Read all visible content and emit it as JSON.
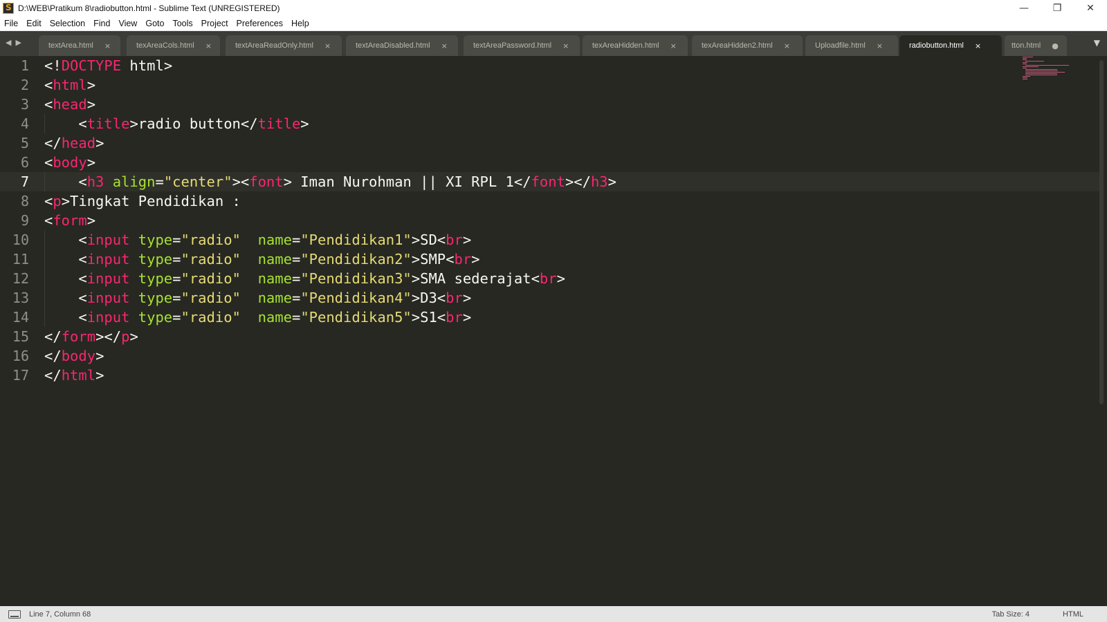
{
  "window": {
    "title": "D:\\WEB\\Pratikum 8\\radiobutton.html - Sublime Text (UNREGISTERED)",
    "minimize": "—",
    "restore": "❐",
    "close": "✕"
  },
  "menu": [
    "File",
    "Edit",
    "Selection",
    "Find",
    "View",
    "Goto",
    "Tools",
    "Project",
    "Preferences",
    "Help"
  ],
  "tabs": [
    {
      "label": "textArea.html",
      "close": "×"
    },
    {
      "label": "texAreaCols.html",
      "close": "×"
    },
    {
      "label": "textAreaReadOnly.html",
      "close": "×"
    },
    {
      "label": "textAreaDisabled.html",
      "close": "×"
    },
    {
      "label": "textAreaPassword.html",
      "close": "×"
    },
    {
      "label": "texAreaHidden.html",
      "close": "×"
    },
    {
      "label": "texAreaHidden2.html",
      "close": "×"
    },
    {
      "label": "Uploadfile.html",
      "close": "×"
    },
    {
      "label": "radiobutton.html",
      "close": "×",
      "active": true
    },
    {
      "label": "tton.html",
      "close": "●"
    }
  ],
  "tab_nav": {
    "left": "◀",
    "right": "▶",
    "dropdown": "▼"
  },
  "code_lines": [
    [
      [
        "p",
        "<!"
      ],
      [
        "t",
        "DOCTYPE"
      ],
      [
        "x",
        " html"
      ],
      [
        "p",
        ">"
      ]
    ],
    [
      [
        "p",
        "<"
      ],
      [
        "t",
        "html"
      ],
      [
        "p",
        ">"
      ]
    ],
    [
      [
        "p",
        "<"
      ],
      [
        "t",
        "head"
      ],
      [
        "p",
        ">"
      ]
    ],
    [
      [
        "x",
        "    "
      ],
      [
        "p",
        "<"
      ],
      [
        "t",
        "title"
      ],
      [
        "p",
        ">"
      ],
      [
        "x",
        "radio button"
      ],
      [
        "p",
        "</"
      ],
      [
        "t",
        "title"
      ],
      [
        "p",
        ">"
      ]
    ],
    [
      [
        "p",
        "</"
      ],
      [
        "t",
        "head"
      ],
      [
        "p",
        ">"
      ]
    ],
    [
      [
        "p",
        "<"
      ],
      [
        "t",
        "body"
      ],
      [
        "p",
        ">"
      ]
    ],
    [
      [
        "x",
        "    "
      ],
      [
        "p",
        "<"
      ],
      [
        "t",
        "h3"
      ],
      [
        "x",
        " "
      ],
      [
        "a",
        "align"
      ],
      [
        "p",
        "="
      ],
      [
        "s",
        "\"center\""
      ],
      [
        "p",
        "><"
      ],
      [
        "t",
        "font"
      ],
      [
        "p",
        ">"
      ],
      [
        "x",
        " Iman Nurohman || XI RPL 1"
      ],
      [
        "p",
        "</"
      ],
      [
        "t",
        "font"
      ],
      [
        "p",
        "></"
      ],
      [
        "t",
        "h3"
      ],
      [
        "p",
        ">"
      ]
    ],
    [
      [
        "p",
        "<"
      ],
      [
        "t",
        "p"
      ],
      [
        "p",
        ">"
      ],
      [
        "x",
        "Tingkat Pendidikan :"
      ]
    ],
    [
      [
        "p",
        "<"
      ],
      [
        "t",
        "form"
      ],
      [
        "p",
        ">"
      ]
    ],
    [
      [
        "x",
        "    "
      ],
      [
        "p",
        "<"
      ],
      [
        "t",
        "input"
      ],
      [
        "x",
        " "
      ],
      [
        "a",
        "type"
      ],
      [
        "p",
        "="
      ],
      [
        "s",
        "\"radio\""
      ],
      [
        "x",
        "  "
      ],
      [
        "a",
        "name"
      ],
      [
        "p",
        "="
      ],
      [
        "s",
        "\"Pendidikan1\""
      ],
      [
        "p",
        ">"
      ],
      [
        "x",
        "SD"
      ],
      [
        "p",
        "<"
      ],
      [
        "t",
        "br"
      ],
      [
        "p",
        ">"
      ]
    ],
    [
      [
        "x",
        "    "
      ],
      [
        "p",
        "<"
      ],
      [
        "t",
        "input"
      ],
      [
        "x",
        " "
      ],
      [
        "a",
        "type"
      ],
      [
        "p",
        "="
      ],
      [
        "s",
        "\"radio\""
      ],
      [
        "x",
        "  "
      ],
      [
        "a",
        "name"
      ],
      [
        "p",
        "="
      ],
      [
        "s",
        "\"Pendidikan2\""
      ],
      [
        "p",
        ">"
      ],
      [
        "x",
        "SMP"
      ],
      [
        "p",
        "<"
      ],
      [
        "t",
        "br"
      ],
      [
        "p",
        ">"
      ]
    ],
    [
      [
        "x",
        "    "
      ],
      [
        "p",
        "<"
      ],
      [
        "t",
        "input"
      ],
      [
        "x",
        " "
      ],
      [
        "a",
        "type"
      ],
      [
        "p",
        "="
      ],
      [
        "s",
        "\"radio\""
      ],
      [
        "x",
        "  "
      ],
      [
        "a",
        "name"
      ],
      [
        "p",
        "="
      ],
      [
        "s",
        "\"Pendidikan3\""
      ],
      [
        "p",
        ">"
      ],
      [
        "x",
        "SMA sederajat"
      ],
      [
        "p",
        "<"
      ],
      [
        "t",
        "br"
      ],
      [
        "p",
        ">"
      ]
    ],
    [
      [
        "x",
        "    "
      ],
      [
        "p",
        "<"
      ],
      [
        "t",
        "input"
      ],
      [
        "x",
        " "
      ],
      [
        "a",
        "type"
      ],
      [
        "p",
        "="
      ],
      [
        "s",
        "\"radio\""
      ],
      [
        "x",
        "  "
      ],
      [
        "a",
        "name"
      ],
      [
        "p",
        "="
      ],
      [
        "s",
        "\"Pendidikan4\""
      ],
      [
        "p",
        ">"
      ],
      [
        "x",
        "D3"
      ],
      [
        "p",
        "<"
      ],
      [
        "t",
        "br"
      ],
      [
        "p",
        ">"
      ]
    ],
    [
      [
        "x",
        "    "
      ],
      [
        "p",
        "<"
      ],
      [
        "t",
        "input"
      ],
      [
        "x",
        " "
      ],
      [
        "a",
        "type"
      ],
      [
        "p",
        "="
      ],
      [
        "s",
        "\"radio\""
      ],
      [
        "x",
        "  "
      ],
      [
        "a",
        "name"
      ],
      [
        "p",
        "="
      ],
      [
        "s",
        "\"Pendidikan5\""
      ],
      [
        "p",
        ">"
      ],
      [
        "x",
        "S1"
      ],
      [
        "p",
        "<"
      ],
      [
        "t",
        "br"
      ],
      [
        "p",
        ">"
      ]
    ],
    [
      [
        "p",
        "</"
      ],
      [
        "t",
        "form"
      ],
      [
        "p",
        "></"
      ],
      [
        "t",
        "p"
      ],
      [
        "p",
        ">"
      ]
    ],
    [
      [
        "p",
        "</"
      ],
      [
        "t",
        "body"
      ],
      [
        "p",
        ">"
      ]
    ],
    [
      [
        "p",
        "</"
      ],
      [
        "t",
        "html"
      ],
      [
        "p",
        ">"
      ]
    ]
  ],
  "current_line": 7,
  "status": {
    "position": "Line 7, Column 68",
    "tab_size": "Tab Size: 4",
    "syntax": "HTML"
  },
  "colors": {
    "tag": "#f92672",
    "attribute": "#a6e22e",
    "string": "#e6db74",
    "text": "#f8f8f2",
    "background": "#272822"
  }
}
